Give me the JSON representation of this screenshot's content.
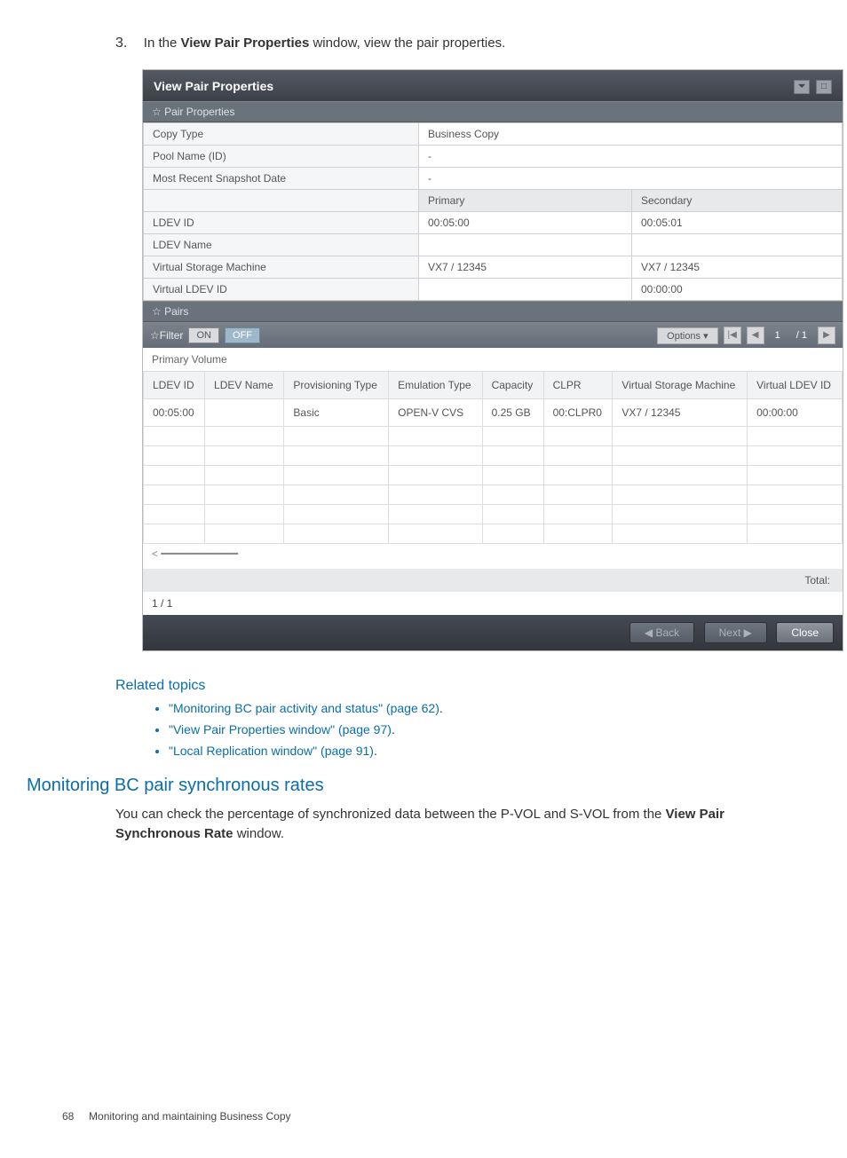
{
  "step": {
    "num": "3.",
    "prefix": "In the ",
    "bold": "View Pair Properties",
    "suffix": " window, view the pair properties."
  },
  "window": {
    "title": "View Pair Properties",
    "sectionA": "☆ Pair Properties",
    "props": {
      "copy_type_label": "Copy Type",
      "copy_type_value": "Business Copy",
      "pool_label": "Pool Name (ID)",
      "pool_value": "-",
      "snap_label": "Most Recent Snapshot Date",
      "snap_value": "-",
      "col_primary": "Primary",
      "col_secondary": "Secondary",
      "ldev_id_label": "LDEV ID",
      "ldev_id_primary": "00:05:00",
      "ldev_id_secondary": "00:05:01",
      "ldev_name_label": "LDEV Name",
      "ldev_name_primary": "",
      "ldev_name_secondary": "",
      "vsm_label": "Virtual Storage Machine",
      "vsm_primary": "VX7 / 12345",
      "vsm_secondary": "VX7 / 12345",
      "vldev_label": "Virtual LDEV ID",
      "vldev_primary": "",
      "vldev_secondary": "00:00:00"
    },
    "sectionB": "☆ Pairs",
    "filter": {
      "label": "☆Filter",
      "on": "ON",
      "off": "OFF",
      "options": "Options ▾",
      "page_field": "1",
      "page_total": "/ 1"
    },
    "subcaption": "Primary Volume",
    "grid": {
      "headers": [
        "LDEV ID",
        "LDEV Name",
        "Provisioning Type",
        "Emulation Type",
        "Capacity",
        "CLPR",
        "Virtual Storage Machine",
        "Virtual LDEV ID"
      ],
      "row": [
        "00:05:00",
        "",
        "Basic",
        "OPEN-V CVS",
        "0.25 GB",
        "00:CLPR0",
        "VX7 / 12345",
        "00:00:00"
      ]
    },
    "total_label": "Total:",
    "pager": "1 / 1",
    "footer": {
      "back": "◀ Back",
      "next": "Next ▶",
      "close": "Close"
    }
  },
  "related": {
    "title": "Related topics",
    "items": [
      {
        "text": "\"Monitoring BC pair activity and status\" (page 62)",
        "tail": "."
      },
      {
        "text": "\"View Pair Properties window\" (page 97)",
        "tail": "."
      },
      {
        "text": "\"Local Replication window\" (page 91)",
        "tail": "."
      }
    ]
  },
  "section2": {
    "title": "Monitoring BC pair synchronous rates",
    "p_prefix": "You can check the percentage of synchronized data between the P-VOL and S-VOL from the ",
    "p_bold": "View Pair Synchronous Rate",
    "p_suffix": " window."
  },
  "footer": {
    "page": "68",
    "chapter": "Monitoring and maintaining Business Copy"
  }
}
